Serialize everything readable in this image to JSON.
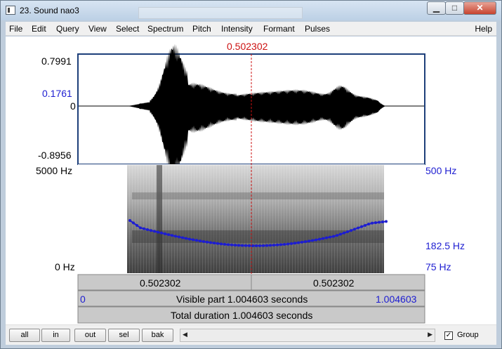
{
  "window": {
    "title": "23. Sound nao3",
    "controls": {
      "minimize": "▁",
      "maximize": "□",
      "close": "✕"
    }
  },
  "menu": {
    "items": [
      "File",
      "Edit",
      "Query",
      "View",
      "Select",
      "Spectrum",
      "Pitch",
      "Intensity",
      "Formant",
      "Pulses"
    ],
    "help": "Help"
  },
  "cursor": {
    "time": "0.502302"
  },
  "waveform": {
    "max": "0.7991",
    "marker": "0.1761",
    "zero": "0",
    "min": "-0.8956"
  },
  "spectrogram": {
    "top_freq": "5000 Hz",
    "bottom_freq": "0 Hz",
    "pitch_top": "500 Hz",
    "pitch_marker": "182.5 Hz",
    "pitch_bottom": "75 Hz"
  },
  "time_bars": {
    "left_value": "0.502302",
    "right_value": "0.502302",
    "visible_start": "0",
    "visible_label": "Visible part 1.004603 seconds",
    "visible_end": "1.004603",
    "total_label": "Total duration 1.004603 seconds"
  },
  "bottom": {
    "buttons": [
      "all",
      "in",
      "out",
      "sel",
      "bak"
    ],
    "scroll_left": "◀",
    "scroll_right": "▶",
    "group_checked": "✓",
    "group_label": "Group"
  },
  "colors": {
    "pitch": "#1d1dd1",
    "cursor": "#cc1111"
  }
}
